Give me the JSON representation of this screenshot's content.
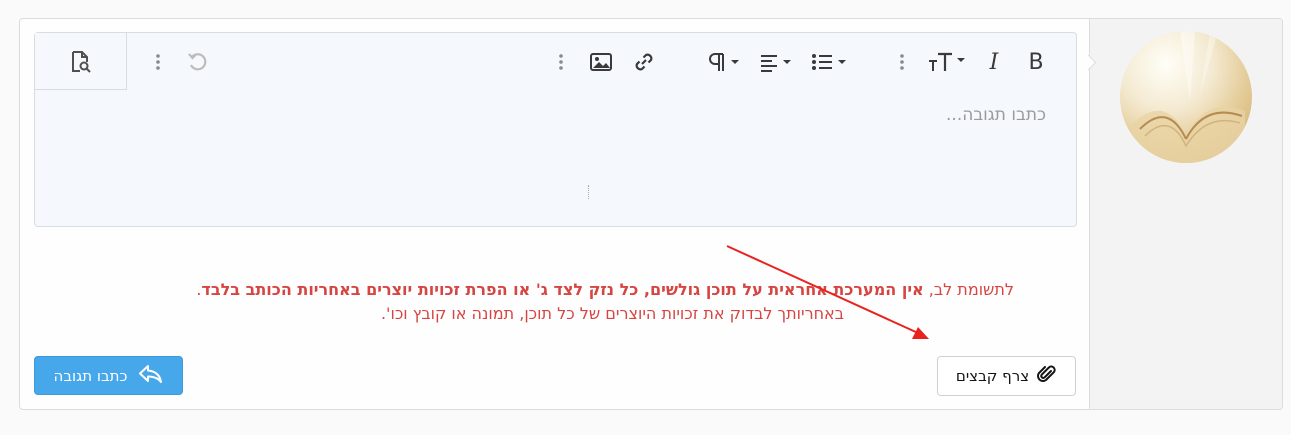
{
  "editor": {
    "placeholder": "כתבו תגובה...",
    "toolbar": {
      "bold": "B",
      "italic": "I",
      "text_size": "TT",
      "preview_icon": "document-search-icon",
      "undo_icon": "undo-icon"
    }
  },
  "notice": {
    "line1_prefix": "לתשומת לב, ",
    "line1_bold": "אין המערכת אחראית על תוכן גולשים, כל נזק לצד ג' או הפרת זכויות יוצרים באחריות הכותב בלבד",
    "line1_suffix": ".",
    "line2": "באחריותך לבדוק את זכויות היוצרים של כל תוכן, תמונה או קובץ וכו'."
  },
  "buttons": {
    "attach_label": "צרף קבצים",
    "reply_label": "כתבו תגובה"
  },
  "colors": {
    "notice_red": "#d64541",
    "reply_blue": "#47a7eb",
    "annotation_arrow": "#e8231f"
  }
}
